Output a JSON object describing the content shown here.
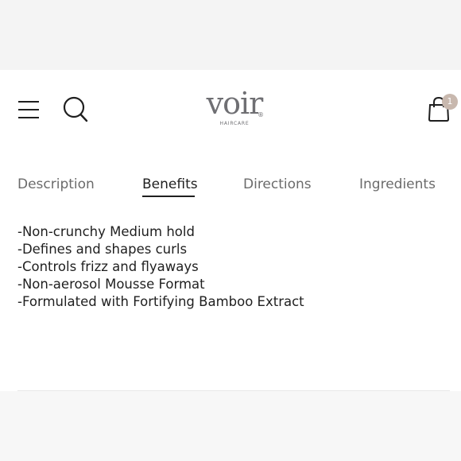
{
  "brand": {
    "name": "voir",
    "subtitle": "HAIRCARE",
    "registered_mark": "®"
  },
  "header": {
    "menu_icon": "hamburger-menu-icon",
    "search_icon": "search-icon",
    "cart_icon": "shopping-bag-icon",
    "cart_count": "1"
  },
  "tabs": [
    {
      "label": "Description",
      "active": false
    },
    {
      "label": "Benefits",
      "active": true
    },
    {
      "label": "Directions",
      "active": false
    },
    {
      "label": "Ingredients",
      "active": false
    }
  ],
  "benefits": [
    "-Non-crunchy Medium hold",
    "-Defines and shapes curls",
    "-Controls frizz and flyaways",
    "-Non-aerosol Mousse Format",
    "-Formulated with Fortifying Bamboo Extract"
  ],
  "colors": {
    "text": "#1f1f1f",
    "muted_tab": "#6b6b6b",
    "logo": "#6f6f73",
    "badge": "#c8b8ae"
  }
}
